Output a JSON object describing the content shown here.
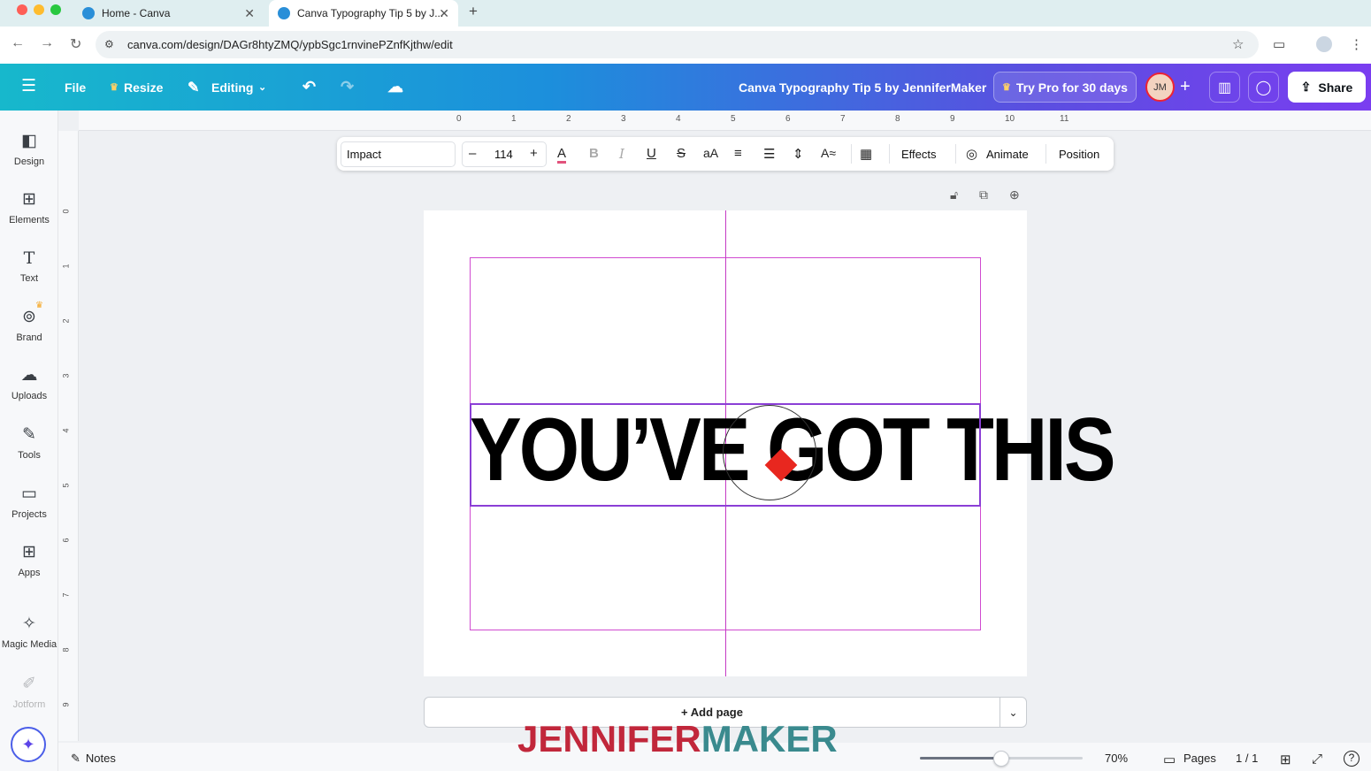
{
  "browser": {
    "tabs": [
      {
        "title": "Home - Canva"
      },
      {
        "title": "Canva Typography Tip 5 by J..."
      }
    ],
    "url": "canva.com/design/DAGr8htyZMQ/ypbSgc1rnvinePZnfKjthw/edit"
  },
  "header": {
    "menu_icon": "hamburger-icon",
    "file_label": "File",
    "resize_label": "Resize",
    "editing_label": "Editing",
    "doc_title": "Canva Typography Tip 5 by JenniferMaker",
    "try_pro_label": "Try Pro for 30 days",
    "share_label": "Share",
    "avatar_initials": "JM",
    "accent_gradient": [
      "#17b8cc",
      "#1c8fdc",
      "#7a3df0"
    ]
  },
  "sidebar": {
    "items": [
      {
        "label": "Design",
        "icon": "design-icon"
      },
      {
        "label": "Elements",
        "icon": "elements-icon"
      },
      {
        "label": "Text",
        "icon": "text-icon"
      },
      {
        "label": "Brand",
        "icon": "brand-icon"
      },
      {
        "label": "Uploads",
        "icon": "uploads-icon"
      },
      {
        "label": "Tools",
        "icon": "tools-icon"
      },
      {
        "label": "Projects",
        "icon": "projects-icon"
      },
      {
        "label": "Apps",
        "icon": "apps-icon"
      },
      {
        "label": "Magic Media",
        "icon": "magic-media-icon"
      },
      {
        "label": "Jotform",
        "icon": "jotform-icon"
      }
    ]
  },
  "ruler": {
    "top": [
      "0",
      "1",
      "2",
      "3",
      "4",
      "5",
      "6",
      "7",
      "8",
      "9",
      "10",
      "11"
    ],
    "left": [
      "0",
      "1",
      "2",
      "3",
      "4",
      "5",
      "6",
      "7",
      "8",
      "9"
    ]
  },
  "toolbar": {
    "font": "Impact",
    "font_size": "114",
    "minus": "–",
    "plus": "+",
    "effects_label": "Effects",
    "animate_label": "Animate",
    "position_label": "Position"
  },
  "canvas": {
    "headline": "YOU’VE GOT THIS",
    "guide_color": "#d04ad0",
    "selection_color": "#8b3fd6",
    "rotate_handle_color": "#e8271f"
  },
  "add_page": {
    "label": "+ Add page"
  },
  "footer": {
    "notes_label": "Notes",
    "zoom": "70%",
    "zoom_fraction": 0.5,
    "pages_label": "Pages",
    "page_count": "1 / 1",
    "help_label": "?"
  },
  "watermark": {
    "part1": "JENNIFER",
    "part2": "MAKER"
  }
}
